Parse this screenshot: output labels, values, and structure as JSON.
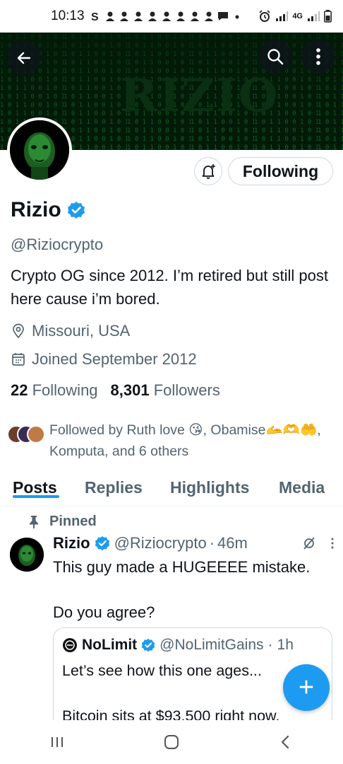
{
  "status_bar": {
    "time": "10:13",
    "network": "4G"
  },
  "banner": {
    "text": "RIZIO"
  },
  "profile": {
    "name": "Rizio",
    "handle": "@Riziocrypto",
    "bio": "Crypto OG since 2012. I’m retired but still post here cause i’m bored.",
    "location": "Missouri, USA",
    "joined": "Joined September 2012",
    "following_count": "22",
    "following_label": "Following",
    "followers_count": "8,301",
    "followers_label": "Followers",
    "followed_by": "Followed by Ruth love 😘, Obamise🫴🫶🤲, Komputa, and 6 others",
    "follow_button_label": "Following"
  },
  "tabs": [
    "Posts",
    "Replies",
    "Highlights",
    "Media"
  ],
  "pinned_label": "Pinned",
  "tweet": {
    "name": "Rizio",
    "handle": "@Riziocrypto",
    "dot": "·",
    "time": "46m",
    "text_line1": "This guy made a HUGEEEE mistake.",
    "text_line2": "Do you agree?",
    "quote": {
      "name": "NoLimit",
      "handle": "@NoLimitGains",
      "dot": "·",
      "time": "1h",
      "text_line1": "Let’s see how this one ages...",
      "text_line2": "Bitcoin sits at $93,500 right now."
    }
  },
  "fab_label": "+",
  "colors": {
    "accent": "#1d9bf0",
    "text_primary": "#0f1419",
    "text_secondary": "#536471",
    "banner_bg": "#021a08",
    "matrix_green": "#1fa83a"
  }
}
